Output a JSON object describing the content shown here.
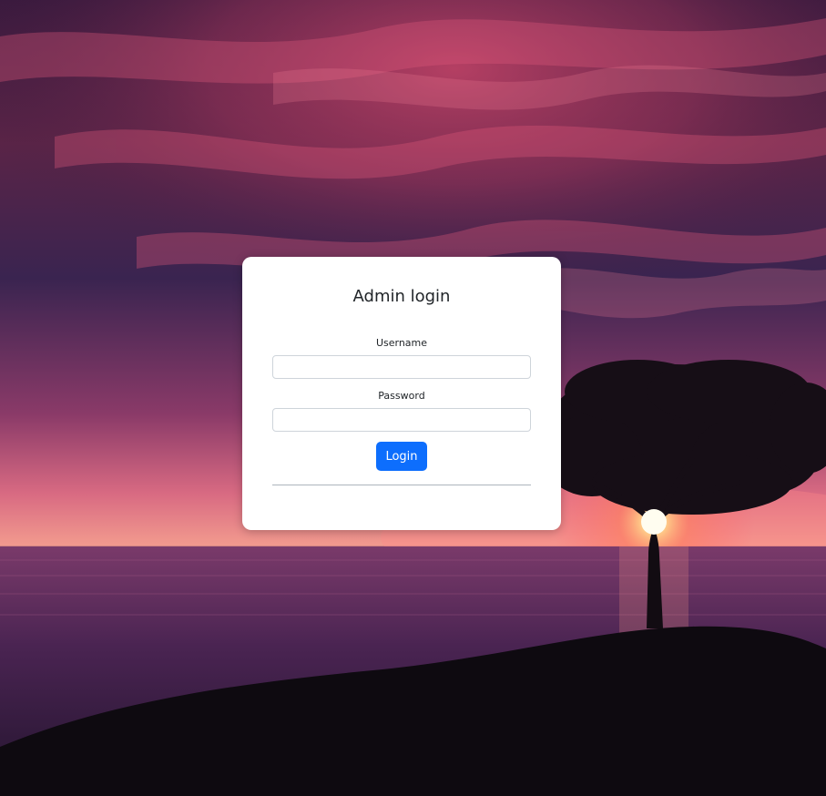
{
  "login": {
    "title": "Admin login",
    "username_label": "Username",
    "username_value": "",
    "password_label": "Password",
    "password_value": "",
    "submit_label": "Login"
  },
  "colors": {
    "button_primary": "#0d6efd",
    "card_background": "#ffffff",
    "sky_dark": "#2a1838",
    "sky_glow": "#c8506e",
    "horizon": "#e07a8a"
  }
}
